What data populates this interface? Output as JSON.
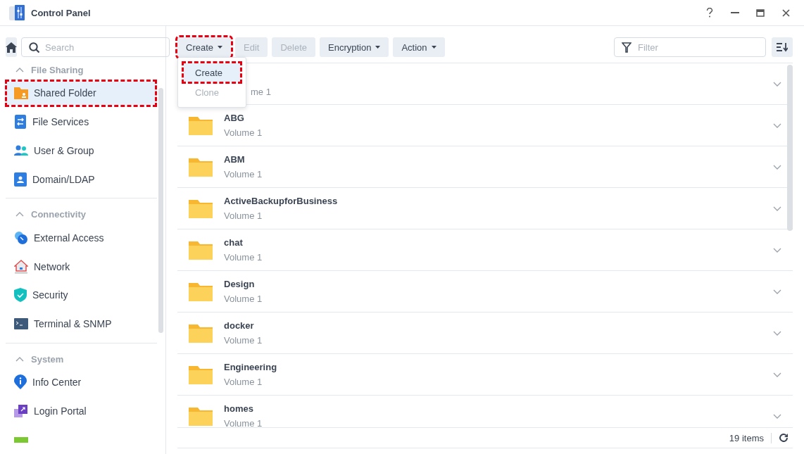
{
  "window": {
    "title": "Control Panel"
  },
  "sidebar": {
    "search_placeholder": "Search",
    "sections": [
      {
        "title": "File Sharing",
        "expanded": true,
        "items": [
          {
            "label": "Shared Folder",
            "selected": true,
            "highlighted": true
          },
          {
            "label": "File Services",
            "selected": false,
            "highlighted": false
          },
          {
            "label": "User & Group",
            "selected": false,
            "highlighted": false
          },
          {
            "label": "Domain/LDAP",
            "selected": false,
            "highlighted": false
          }
        ]
      },
      {
        "title": "Connectivity",
        "expanded": true,
        "items": [
          {
            "label": "External Access",
            "selected": false,
            "highlighted": false
          },
          {
            "label": "Network",
            "selected": false,
            "highlighted": false
          },
          {
            "label": "Security",
            "selected": false,
            "highlighted": false
          },
          {
            "label": "Terminal & SNMP",
            "selected": false,
            "highlighted": false
          }
        ]
      },
      {
        "title": "System",
        "expanded": true,
        "items": [
          {
            "label": "Info Center",
            "selected": false,
            "highlighted": false
          },
          {
            "label": "Login Portal",
            "selected": false,
            "highlighted": false
          },
          {
            "selected": false,
            "highlighted": false
          }
        ]
      }
    ]
  },
  "toolbar": {
    "buttons": [
      {
        "label": "Create",
        "caret": true,
        "disabled": false,
        "highlighted": true
      },
      {
        "label": "Edit",
        "caret": false,
        "disabled": true,
        "highlighted": false
      },
      {
        "label": "Delete",
        "caret": false,
        "disabled": true,
        "highlighted": false
      },
      {
        "label": "Encryption",
        "caret": true,
        "disabled": false,
        "highlighted": false
      },
      {
        "label": "Action",
        "caret": true,
        "disabled": false,
        "highlighted": false
      }
    ],
    "filter_placeholder": "Filter"
  },
  "dropdown": {
    "items": [
      {
        "label": "Create",
        "disabled": false,
        "selected": true,
        "highlighted": true
      },
      {
        "label": "Clone",
        "disabled": true,
        "selected": false,
        "highlighted": false
      }
    ]
  },
  "folders": [
    {
      "kind": "covered",
      "subtitle": "me 1"
    },
    {
      "kind": "full",
      "name": "ABG",
      "subtitle": "Volume 1"
    },
    {
      "kind": "full",
      "name": "ABM",
      "subtitle": "Volume 1"
    },
    {
      "kind": "full",
      "name": "ActiveBackupforBusiness",
      "subtitle": "Volume 1"
    },
    {
      "kind": "full",
      "name": "chat",
      "subtitle": "Volume 1"
    },
    {
      "kind": "full",
      "name": "Design",
      "subtitle": "Volume 1"
    },
    {
      "kind": "full",
      "name": "docker",
      "subtitle": "Volume 1"
    },
    {
      "kind": "full",
      "name": "Engineering",
      "subtitle": "Volume 1"
    },
    {
      "kind": "full",
      "name": "homes",
      "subtitle": "Volume 1"
    }
  ],
  "status_bar": {
    "count": "19 items"
  }
}
